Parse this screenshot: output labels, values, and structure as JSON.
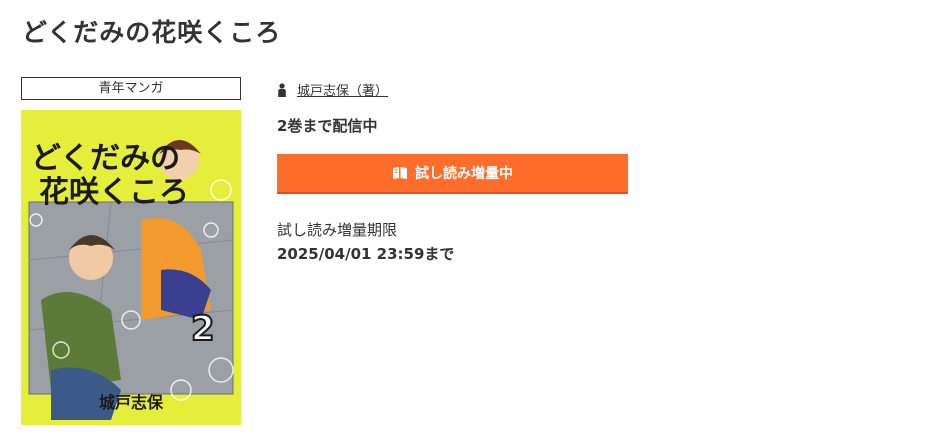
{
  "page": {
    "title": "どくだみの花咲くころ"
  },
  "genre": {
    "label": "青年マンガ"
  },
  "cover": {
    "title_text": "どくだみの花咲くころ",
    "volume": "2",
    "author_text": "城戸志保"
  },
  "author": {
    "icon": "person-icon",
    "name": "城戸志保（著）"
  },
  "status": {
    "volumes": "2巻まで配信中"
  },
  "trial_button": {
    "icon": "book-icon",
    "label": "試し読み増量中",
    "color": "#ff6d2a"
  },
  "trial_period": {
    "label": "試し読み増量期限",
    "date": "2025/04/01 23:59まで"
  }
}
